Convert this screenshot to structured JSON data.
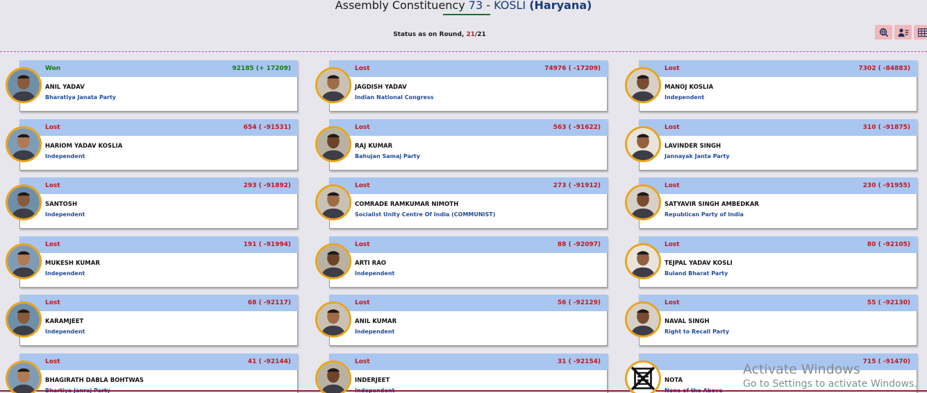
{
  "header": {
    "title_prefix": "Assembly Constituency",
    "ac_number": "73",
    "separator": " - ",
    "ac_name": "KOSLI",
    "state": "(Haryana)"
  },
  "status": {
    "label": "Status as on Round,",
    "current_round": "21",
    "total_rounds": "/21"
  },
  "toolbar": {
    "icons": [
      "globe-search-icon",
      "user-list-icon",
      "table-grid-icon"
    ]
  },
  "candidates": [
    {
      "status": "Won",
      "name": "ANIL YADAV",
      "party": "Bharatiya Janata Party",
      "votes": "92185 (+ 17209)",
      "won": true
    },
    {
      "status": "Lost",
      "name": "JAGDISH YADAV",
      "party": "Indian National Congress",
      "votes": "74976 ( -17209)"
    },
    {
      "status": "Lost",
      "name": "MANOJ KOSLIA",
      "party": "Independent",
      "votes": "7302 ( -84883)"
    },
    {
      "status": "Lost",
      "name": "HARIOM YADAV KOSLIA",
      "party": "Independent",
      "votes": "654 ( -91531)"
    },
    {
      "status": "Lost",
      "name": "RAJ KUMAR",
      "party": "Bahujan Samaj Party",
      "votes": "563 ( -91622)"
    },
    {
      "status": "Lost",
      "name": "LAVINDER SINGH",
      "party": "Jannayak Janta Party",
      "votes": "310 ( -91875)"
    },
    {
      "status": "Lost",
      "name": "SANTOSH",
      "party": "Independent",
      "votes": "293 ( -91892)"
    },
    {
      "status": "Lost",
      "name": "COMRADE RAMKUMAR NIMOTH",
      "party": "Socialist Unity Centre Of India (COMMUNIST)",
      "votes": "273 ( -91912)"
    },
    {
      "status": "Lost",
      "name": "SATYAVIR SINGH AMBEDKAR",
      "party": "Republican Party of India",
      "votes": "230 ( -91955)"
    },
    {
      "status": "Lost",
      "name": "MUKESH KUMAR",
      "party": "Independent",
      "votes": "191 ( -91994)"
    },
    {
      "status": "Lost",
      "name": "ARTI RAO",
      "party": "Independent",
      "votes": "88 ( -92097)"
    },
    {
      "status": "Lost",
      "name": "TEJPAL YADAV KOSLI",
      "party": "Buland Bharat Party",
      "votes": "80 ( -92105)"
    },
    {
      "status": "Lost",
      "name": "KARAMJEET",
      "party": "Independent",
      "votes": "68 ( -92117)"
    },
    {
      "status": "Lost",
      "name": "ANIL KUMAR",
      "party": "Independent",
      "votes": "56 ( -92129)"
    },
    {
      "status": "Lost",
      "name": "NAVAL SINGH",
      "party": "Right to Recall Party",
      "votes": "55 ( -92130)"
    },
    {
      "status": "Lost",
      "name": "BHAGIRATH DABLA BOHTWAS",
      "party": "Bhartiya Janraj Party",
      "votes": "41 ( -92144)"
    },
    {
      "status": "Lost",
      "name": "INDERJEET",
      "party": "Independent",
      "votes": "31 ( -92154)"
    },
    {
      "status": "",
      "name": "NOTA",
      "party": "None of the Above",
      "votes": "715 ( -91470)",
      "nota": true
    }
  ],
  "watermark": {
    "line1": "Activate Windows",
    "line2": "Go to Settings to activate Windows."
  },
  "colors": {
    "header_bar": "#a8c6f0",
    "won": "#137a13",
    "lost": "#c2161c",
    "party": "#1e4b9b",
    "avatar_ring": "#e8a41a"
  }
}
